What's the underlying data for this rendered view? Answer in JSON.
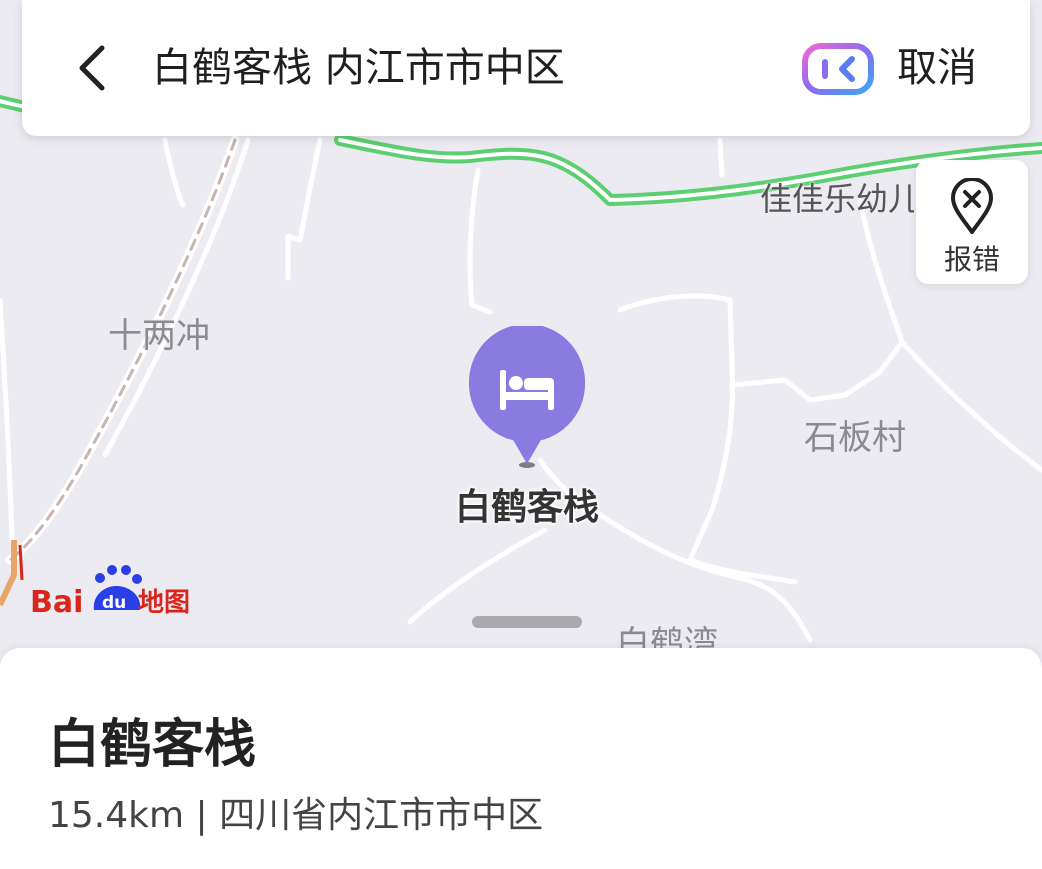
{
  "search": {
    "query": "白鹤客栈 内江市市中区",
    "cancel_label": "取消"
  },
  "map": {
    "report_label": "报错",
    "labels": {
      "jiajiale": "佳佳乐幼儿",
      "shiliangchong": "十两冲",
      "shibancun": "石板村",
      "baihewan": "白鹤湾"
    },
    "poi": {
      "name": "白鹤客栈",
      "icon": "hotel-bed-icon",
      "color": "#8a7be0"
    },
    "logo_text": {
      "bai": "Bai",
      "du": "du",
      "ditu": "地图"
    }
  },
  "place": {
    "name": "白鹤客栈",
    "distance": "15.4km",
    "separator": "|",
    "region": "四川省内江市市中区"
  },
  "colors": {
    "road_green": "#5ccf72",
    "map_bg": "#ecebf1",
    "logo_red": "#d9261c",
    "logo_blue": "#2a3fe8"
  }
}
